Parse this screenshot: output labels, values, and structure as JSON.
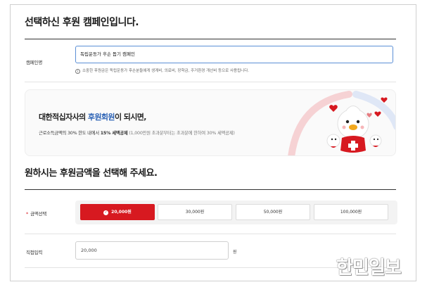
{
  "campaign_section": {
    "title": "선택하신 후원 캠페인입니다.",
    "label": "캠페인명",
    "value": "독립운동가 후손 돕기 캠페인",
    "hint": "소중한 후원금은 독립운동가 후손분들에게 생계비, 의료비, 장학금, 주거환경 개선비 등으로 사용됩니다."
  },
  "banner": {
    "title_prefix": "대한적십자사의 ",
    "title_emphasis": "후원회원",
    "title_suffix": "이 되시면,",
    "sub_prefix": "근로소득금액의 30% 한도 내에서 ",
    "sub_bold": "15% 세액공제",
    "sub_muted": " (1,000만원 초과분부터는 초과분에 한하여 30% 세액공제)"
  },
  "amount_section": {
    "title": "원하시는 후원금액을 선택해 주세요.",
    "required_mark": "*",
    "label": "금액선택",
    "options": [
      {
        "label": "20,000원",
        "selected": true
      },
      {
        "label": "30,000원",
        "selected": false
      },
      {
        "label": "50,000원",
        "selected": false
      },
      {
        "label": "100,000원",
        "selected": false
      }
    ],
    "direct_label": "직접입력",
    "direct_value": "20,000",
    "unit": "원"
  },
  "watermark": "한민일보",
  "colors": {
    "accent_red": "#d71920",
    "accent_blue": "#2c62b5",
    "input_focus": "#5b8fd6"
  },
  "icons": {
    "hint": "info-circle-icon",
    "selected": "check-circle-icon",
    "mascot": "red-cross-mascot-icon"
  }
}
